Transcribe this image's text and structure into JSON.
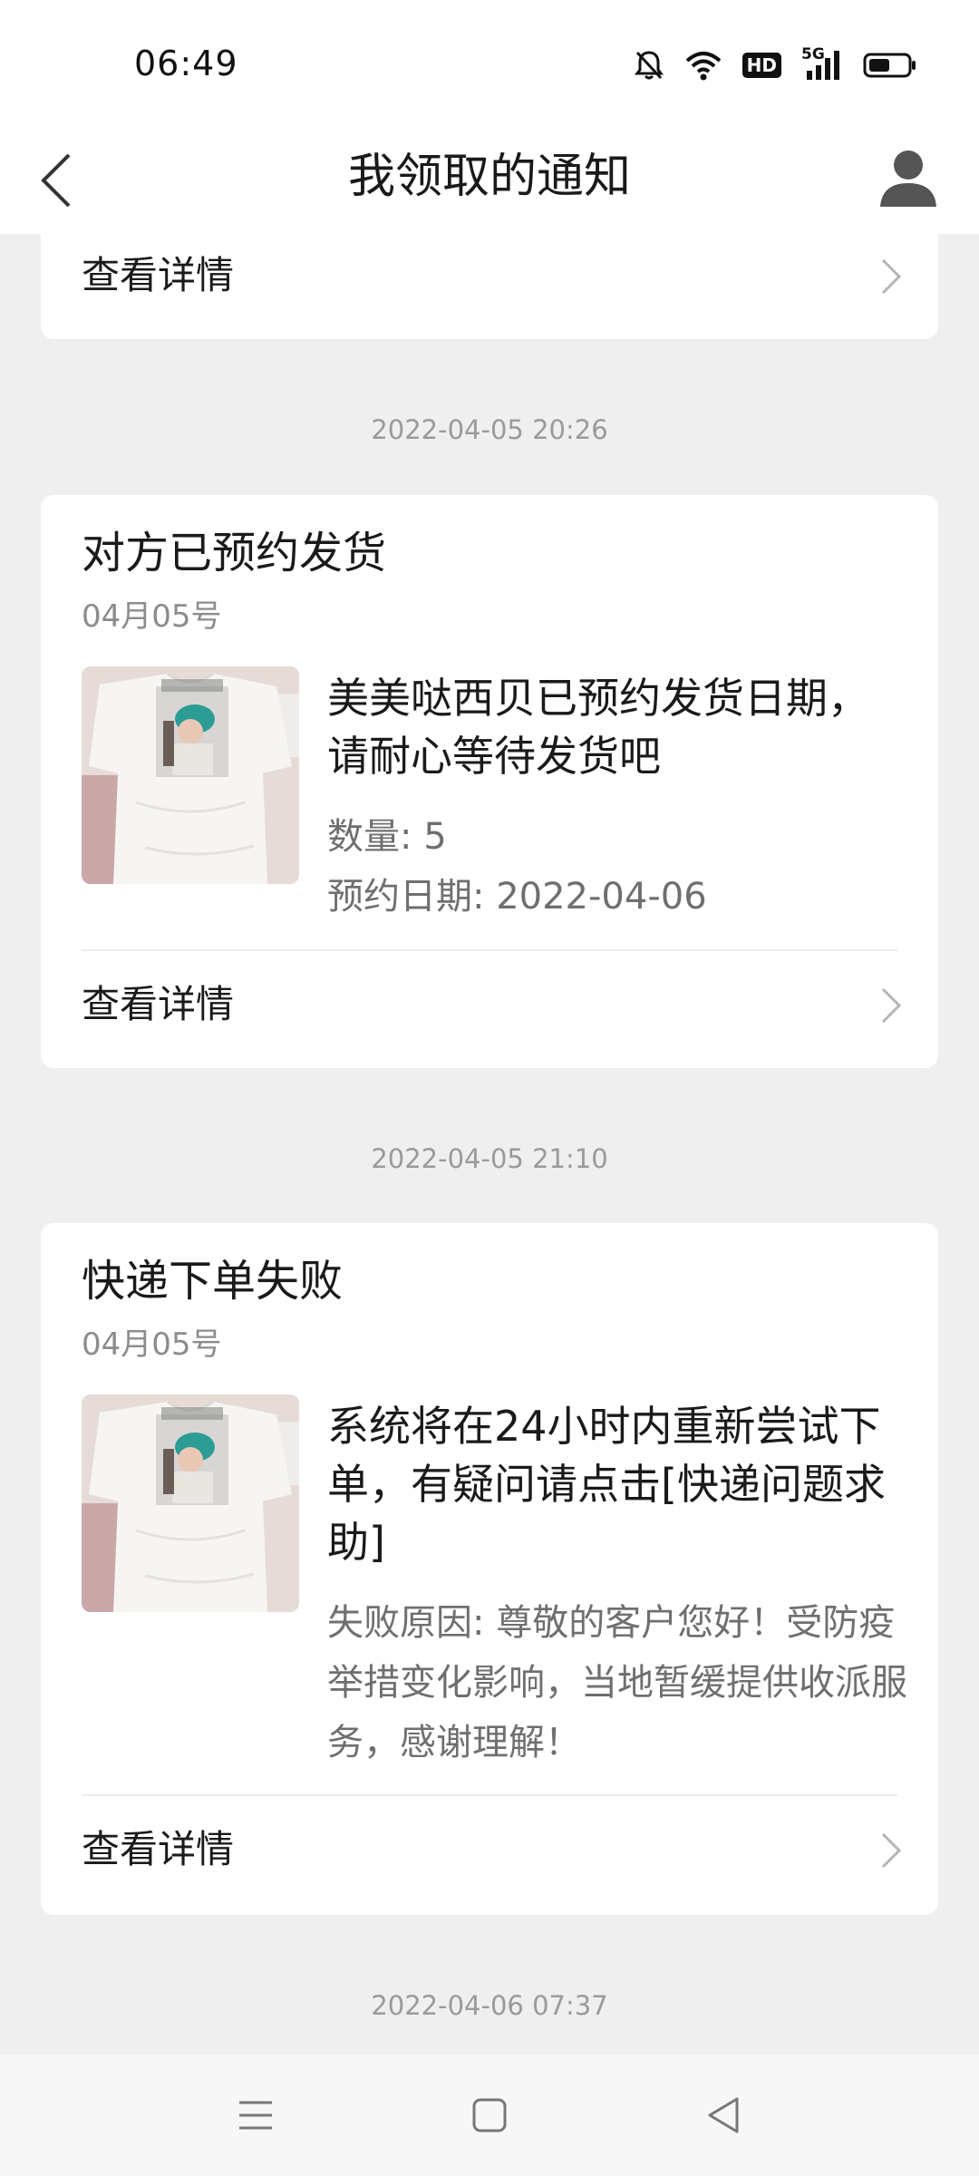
{
  "status_bar": {
    "time": "06:49",
    "icons": [
      "mute-bell-icon",
      "wifi-icon",
      "hd-badge",
      "5g-signal-icon",
      "battery-icon"
    ],
    "hd_label": "HD",
    "network_label": "5G"
  },
  "header": {
    "title": "我领取的通知",
    "back_icon": "chevron-left-icon",
    "profile_icon": "person-icon"
  },
  "notifications": [
    {
      "detail_label": "查看详情"
    },
    {
      "timestamp": "2022-04-05 20:26",
      "title": "对方已预约发货",
      "date": "04月05号",
      "description": "美美哒西贝已预约发货日期，请耐心等待发货吧",
      "meta_lines": [
        "数量: 5",
        "预约日期: 2022-04-06"
      ],
      "detail_label": "查看详情"
    },
    {
      "timestamp": "2022-04-05 21:10",
      "title": "快递下单失败",
      "date": "04月05号",
      "description": "系统将在24小时内重新尝试下单，有疑问请点击[快递问题求助]",
      "meta_text": "失败原因: 尊敬的客户您好！受防疫举措变化影响，当地暂缓提供收派服务，感谢理解！",
      "detail_label": "查看详情"
    },
    {
      "timestamp": "2022-04-06 07:37"
    }
  ],
  "nav_bar": {
    "icons": [
      "menu-icon",
      "home-square-icon",
      "back-triangle-icon"
    ]
  },
  "colors": {
    "background": "#efefef",
    "card": "#ffffff",
    "text_primary": "#1a1a1a",
    "text_secondary": "#8c8c8c"
  }
}
